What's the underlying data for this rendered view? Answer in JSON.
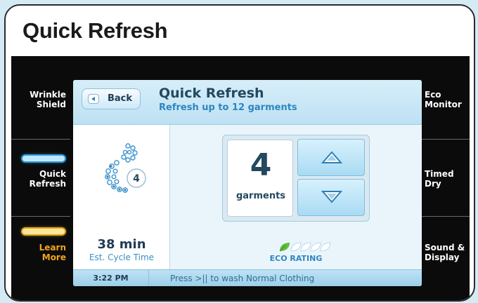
{
  "frame": {
    "title": "Quick Refresh"
  },
  "left_menu": [
    {
      "label_line1": "Wrinkle",
      "label_line2": "Shield",
      "indicator": "none"
    },
    {
      "label_line1": "Quick",
      "label_line2": "Refresh",
      "indicator": "blue-pill"
    },
    {
      "label_line1": "Learn",
      "label_line2": "More",
      "indicator": "yellow-pill"
    }
  ],
  "right_menu": [
    {
      "label_line1": "Eco",
      "label_line2": "Monitor"
    },
    {
      "label_line1": "Timed",
      "label_line2": "Dry"
    },
    {
      "label_line1": "Sound &",
      "label_line2": "Display"
    }
  ],
  "screen": {
    "back_label": "Back",
    "title": "Quick Refresh",
    "subtitle": "Refresh up to 12 garments",
    "cycle_icon_badge": "4",
    "cycle_time": "38 min",
    "cycle_time_caption": "Est. Cycle Time",
    "garment_count": "4",
    "garment_unit": "garments",
    "eco_rating_label": "ECO RATING",
    "eco_rating_value": 1,
    "eco_rating_max": 5
  },
  "status_bar": {
    "time": "3:22 PM",
    "message": "Press >|| to wash Normal Clothing"
  },
  "colors": {
    "panel_bg": "#0b0b0b",
    "accent_blue": "#2e86c0",
    "learn_more_orange": "#f2a41c",
    "screen_bg": "#eaf5fb"
  }
}
